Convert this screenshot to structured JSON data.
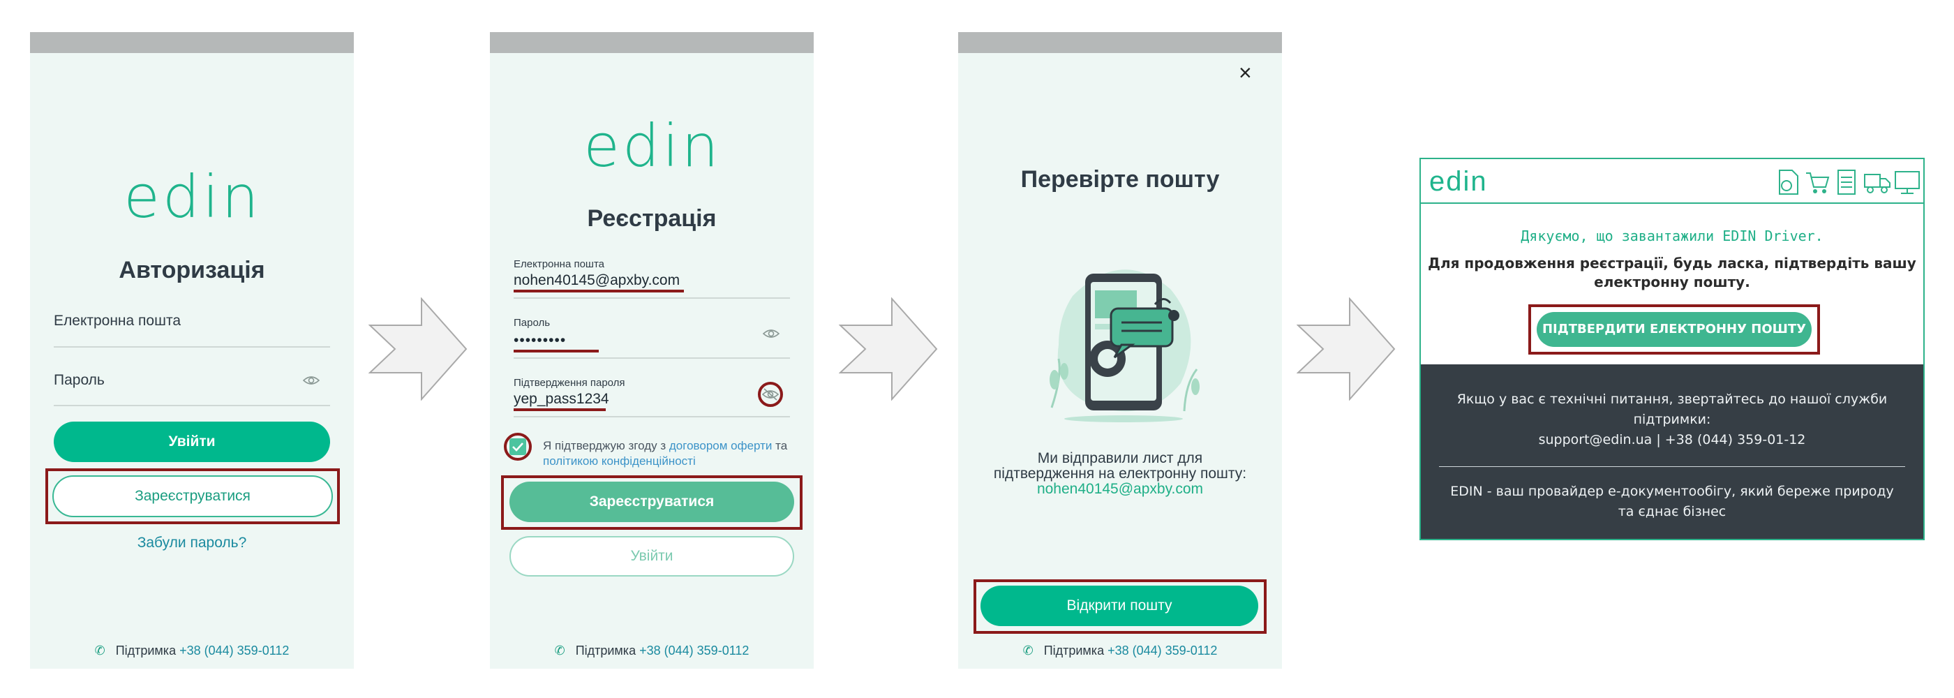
{
  "screen1": {
    "logo_text": "edin",
    "title": "Авторизація",
    "email_label": "Електронна пошта",
    "password_label": "Пароль",
    "login_button": "Увійти",
    "register_button": "Зареєструватися",
    "forgot_password": "Забули пароль?",
    "support_label": "Підтримка",
    "support_phone": "+38 (044) 359-0112"
  },
  "screen2": {
    "logo_text": "edin",
    "title": "Реєстрація",
    "email_label": "Електронна пошта",
    "email_value": "nohen40145@apxby.com",
    "password_label": "Пароль",
    "password_value": "•••••••••",
    "confirm_label": "Підтвердження пароля",
    "confirm_value": "yep_pass1234",
    "consent_prefix": "Я підтверджую згоду з",
    "consent_link1": "договором оферти",
    "consent_and": "та",
    "consent_link2": "політикою конфіденційності",
    "register_button": "Зареєструватися",
    "login_button": "Увійти",
    "support_label": "Підтримка",
    "support_phone": "+38 (044) 359-0112"
  },
  "screen3": {
    "close_symbol": "×",
    "title": "Перевірте пошту",
    "message_line1": "Ми відправили лист для",
    "message_line2": "підтвердження на електронну пошту:",
    "email": "nohen40145@apxby.com",
    "open_mail_button": "Відкрити пошту",
    "support_label": "Підтримка",
    "support_phone": "+38 (044) 359-0112"
  },
  "email": {
    "logo_text": "edin",
    "thanks": "Дякуємо, що завантажили EDIN Driver.",
    "instruction_line1": "Для продовження реєстрації, будь ласка, підтвердіть вашу",
    "instruction_line2": "електронну пошту.",
    "confirm_button": "ПІДТВЕРДИТИ ЕЛЕКТРОННУ ПОШТУ",
    "footer_line1": "Якщо у вас є технічні питання, звертайтесь до нашої служби",
    "footer_line2": "підтримки:",
    "footer_contacts": "support@edin.ua | +38 (044) 359-01-12",
    "footer_slogan1": "EDIN - ваш провайдер е-документообігу, який береже природу",
    "footer_slogan2": "та єднає бізнес"
  },
  "colors": {
    "brand_green": "#00b88d",
    "annotation_red": "#8b1a1a",
    "screen_bg": "#eef7f4",
    "email_footer_bg": "#363e45"
  },
  "icons": [
    "phone-icon",
    "eye-icon",
    "eye-off-icon",
    "checkbox-checked-icon",
    "close-icon",
    "arrow-right-icon",
    "document-icon",
    "cart-icon",
    "invoice-icon",
    "truck-icon",
    "monitor-icon"
  ]
}
